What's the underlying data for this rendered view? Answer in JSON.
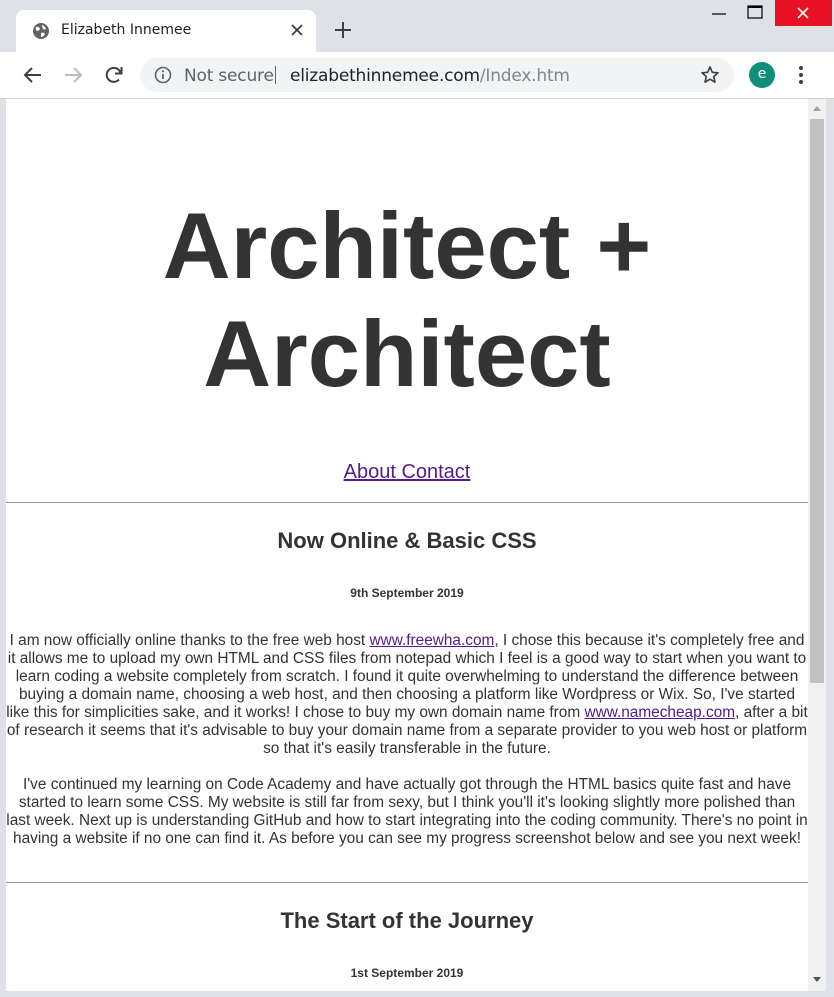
{
  "browser": {
    "tab_title": "Elizabeth Innemee",
    "security_label": "Not secure",
    "url_host": "elizabethinnemee.com",
    "url_path": "/Index.htm",
    "profile_initial": "e",
    "colors": {
      "titlebar": "#dee1e6",
      "close_button": "#e81123",
      "avatar": "#0f8f7b"
    }
  },
  "page": {
    "site_title_line1": "Architect +",
    "site_title_line2": "Architect",
    "nav": {
      "about": "About",
      "contact": "Contact"
    },
    "colors": {
      "text": "#333333",
      "link": "#551a8b"
    },
    "posts": [
      {
        "title": "Now Online & Basic CSS",
        "date": "9th September 2019",
        "p1_a": "I am now officially online thanks to the free web host ",
        "p1_link1": "www.freewha.com",
        "p1_b": ", I chose this because it's completely free and it allows me to upload my own HTML and CSS files from notepad which I feel is a good way to start when you want to learn coding a website completely from scratch. I found it quite overwhelming to understand the difference between buying a domain name, choosing a web host, and then choosing a platform like Wordpress or Wix. So, I've started like this for simplicities sake, and it works! I chose to buy my own domain name from ",
        "p1_link2": "www.namecheap.com",
        "p1_c": ", after a bit of research it seems that it's advisable to buy your domain name from a separate provider to you web host or platform so that it's easily transferable in the future.",
        "p2": "I've continued my learning on Code Academy and have actually got through the HTML basics quite fast and have started to learn some CSS. My website is still far from sexy, but I think you'll it's looking slightly more polished than last week. Next up is understanding GitHub and how to start integrating into the coding community. There's no point in having a website if no one can find it. As before you can see my progress screenshot below and see you next week!"
      },
      {
        "title": "The Start of the Journey",
        "date": "1st September 2019"
      }
    ]
  }
}
